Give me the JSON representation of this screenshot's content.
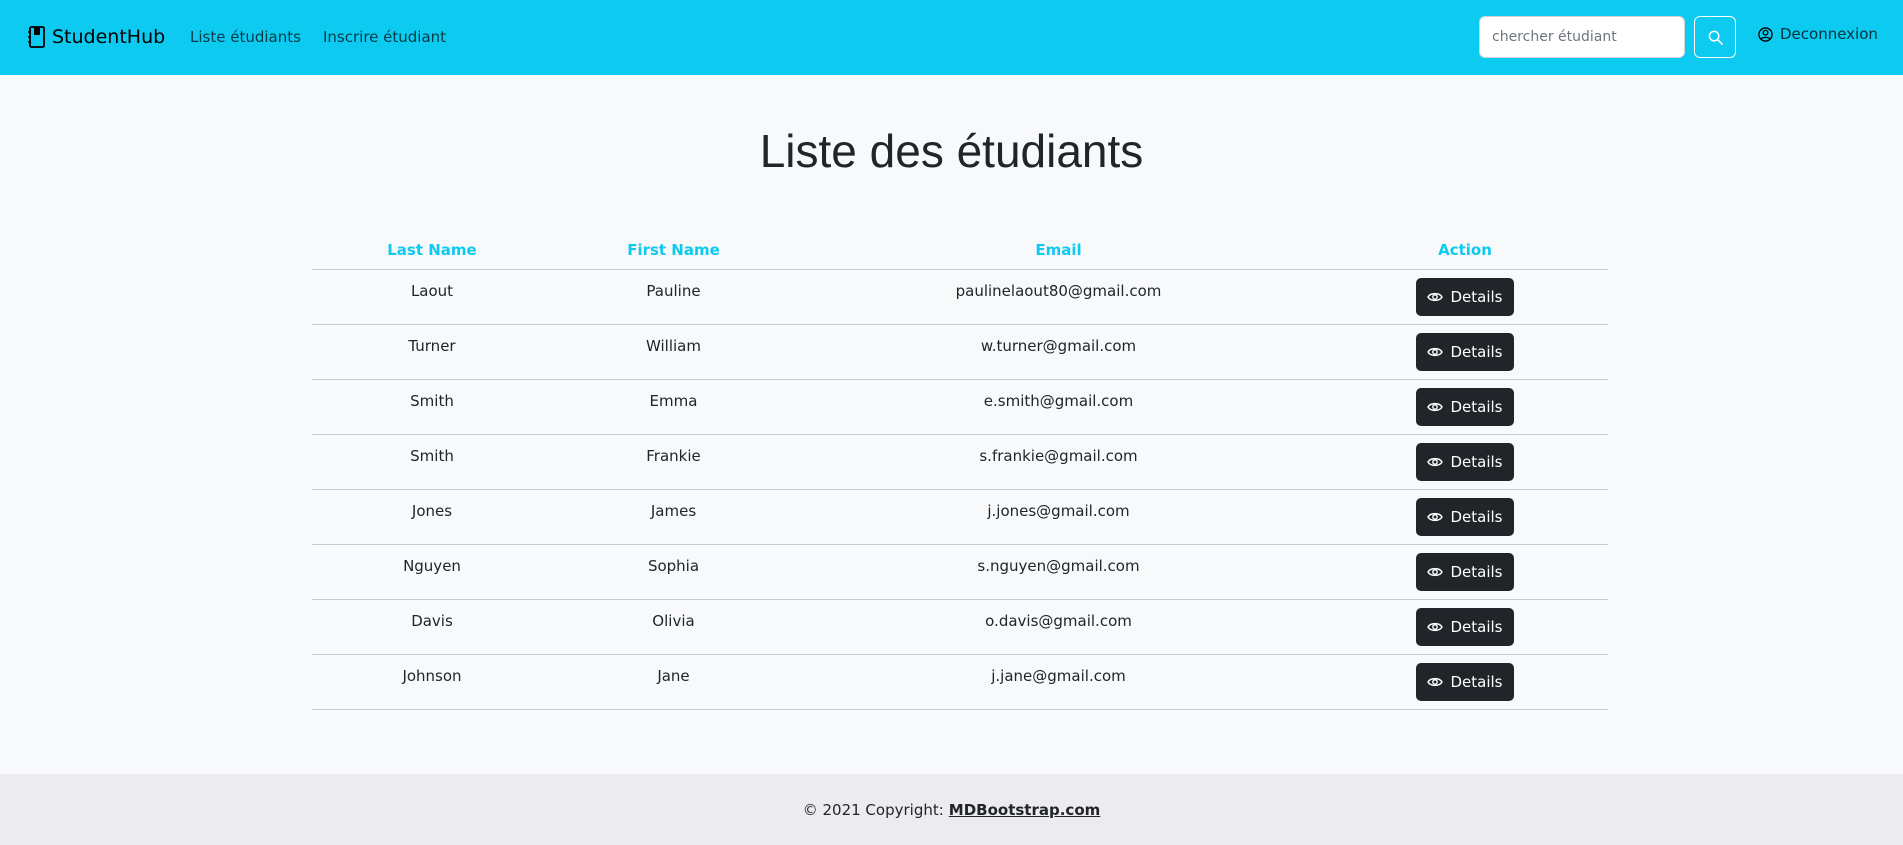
{
  "navbar": {
    "brand": "StudentHub",
    "links": [
      "Liste étudiants",
      "Inscrire étudiant"
    ],
    "search_placeholder": "chercher étudiant",
    "logout_label": "Deconnexion",
    "background_color": "#0dcaf0"
  },
  "main": {
    "title": "Liste des étudiants",
    "headers": {
      "last_name": "Last Name",
      "first_name": "First Name",
      "email": "Email",
      "action": "Action"
    },
    "button_label": "Details",
    "students": [
      {
        "last": "Laout",
        "first": "Pauline",
        "email": "paulinelaout80@gmail.com"
      },
      {
        "last": "Turner",
        "first": "William",
        "email": "w.turner@gmail.com"
      },
      {
        "last": "Smith",
        "first": "Emma",
        "email": "e.smith@gmail.com"
      },
      {
        "last": "Smith",
        "first": "Frankie",
        "email": "s.frankie@gmail.com"
      },
      {
        "last": "Jones",
        "first": "James",
        "email": "j.jones@gmail.com"
      },
      {
        "last": "Nguyen",
        "first": "Sophia",
        "email": "s.nguyen@gmail.com"
      },
      {
        "last": "Davis",
        "first": "Olivia",
        "email": "o.davis@gmail.com"
      },
      {
        "last": "Johnson",
        "first": "Jane",
        "email": "j.jane@gmail.com"
      }
    ]
  },
  "footer": {
    "copyright": "© 2021 Copyright:",
    "link": "MDBootstrap.com"
  }
}
